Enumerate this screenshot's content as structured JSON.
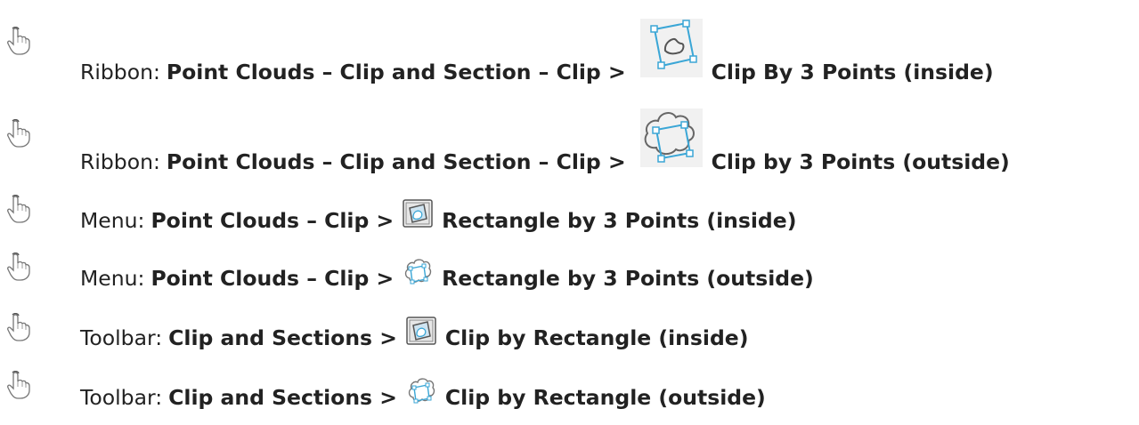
{
  "items": [
    {
      "lead": "Ribbon:",
      "path": "Point Clouds – Clip and Section – Clip >",
      "icon": "clip-inside-large-icon",
      "command": "Clip By 3 Points (inside)"
    },
    {
      "lead": "Ribbon:",
      "path": "Point Clouds – Clip and Section – Clip >",
      "icon": "clip-outside-large-icon",
      "command": "Clip by 3 Points (outside)"
    },
    {
      "lead": "Menu:",
      "path": "Point Clouds – Clip >",
      "icon": "rectangle-inside-icon",
      "command": "Rectangle by 3 Points (inside)"
    },
    {
      "lead": "Menu:",
      "path": "Point Clouds – Clip >",
      "icon": "rectangle-outside-icon",
      "command": "Rectangle by 3 Points (outside)"
    },
    {
      "lead": "Toolbar:",
      "path": "Clip and Sections >",
      "icon": "rectangle-inside-icon",
      "command": "Clip by Rectangle (inside)"
    },
    {
      "lead": "Toolbar:",
      "path": "Clip and Sections >",
      "icon": "rectangle-outside-icon",
      "command": "Clip by Rectangle (outside)"
    }
  ],
  "colors": {
    "text": "#222222",
    "icon_blue": "#3aa6d6",
    "icon_gray": "#555555"
  }
}
